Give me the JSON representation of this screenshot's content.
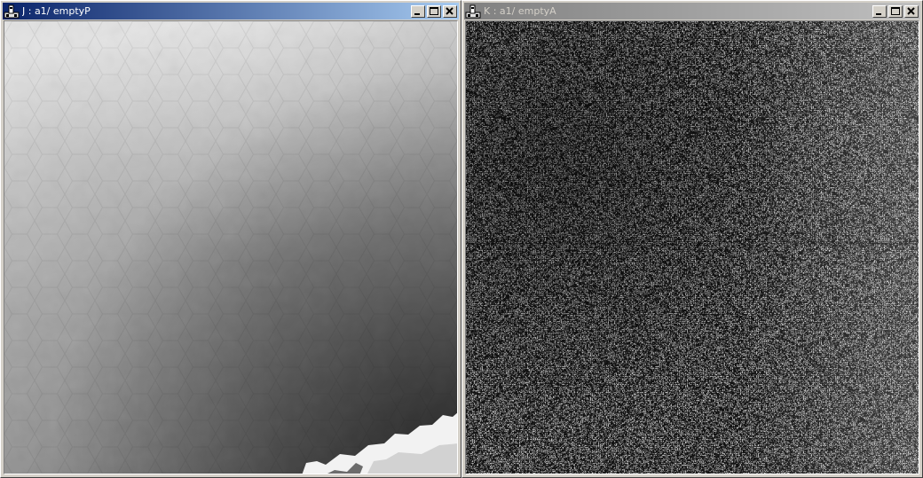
{
  "windows": [
    {
      "title": "J : a1/ emptyP",
      "state": "active",
      "icon": "microscope-icon",
      "buttons": {
        "minimize": "minimize-icon",
        "maximize": "maximize-icon",
        "close": "close-icon"
      }
    },
    {
      "title": "K : a1/ emptyA",
      "state": "inactive",
      "icon": "microscope-icon",
      "buttons": {
        "minimize": "minimize-icon",
        "maximize": "maximize-icon",
        "close": "close-icon"
      }
    }
  ],
  "colors": {
    "window_face": "#d4d0c8",
    "active_title_start": "#0a246a",
    "active_title_end": "#a6caf0",
    "inactive_title_start": "#808080",
    "inactive_title_end": "#c0c0c0"
  },
  "images": {
    "left": "grayscale phase image, gradient light to dark with hexagonal tiling and white saturated region bottom-right",
    "right": "grayscale amplitude image, speckled noise texture"
  }
}
